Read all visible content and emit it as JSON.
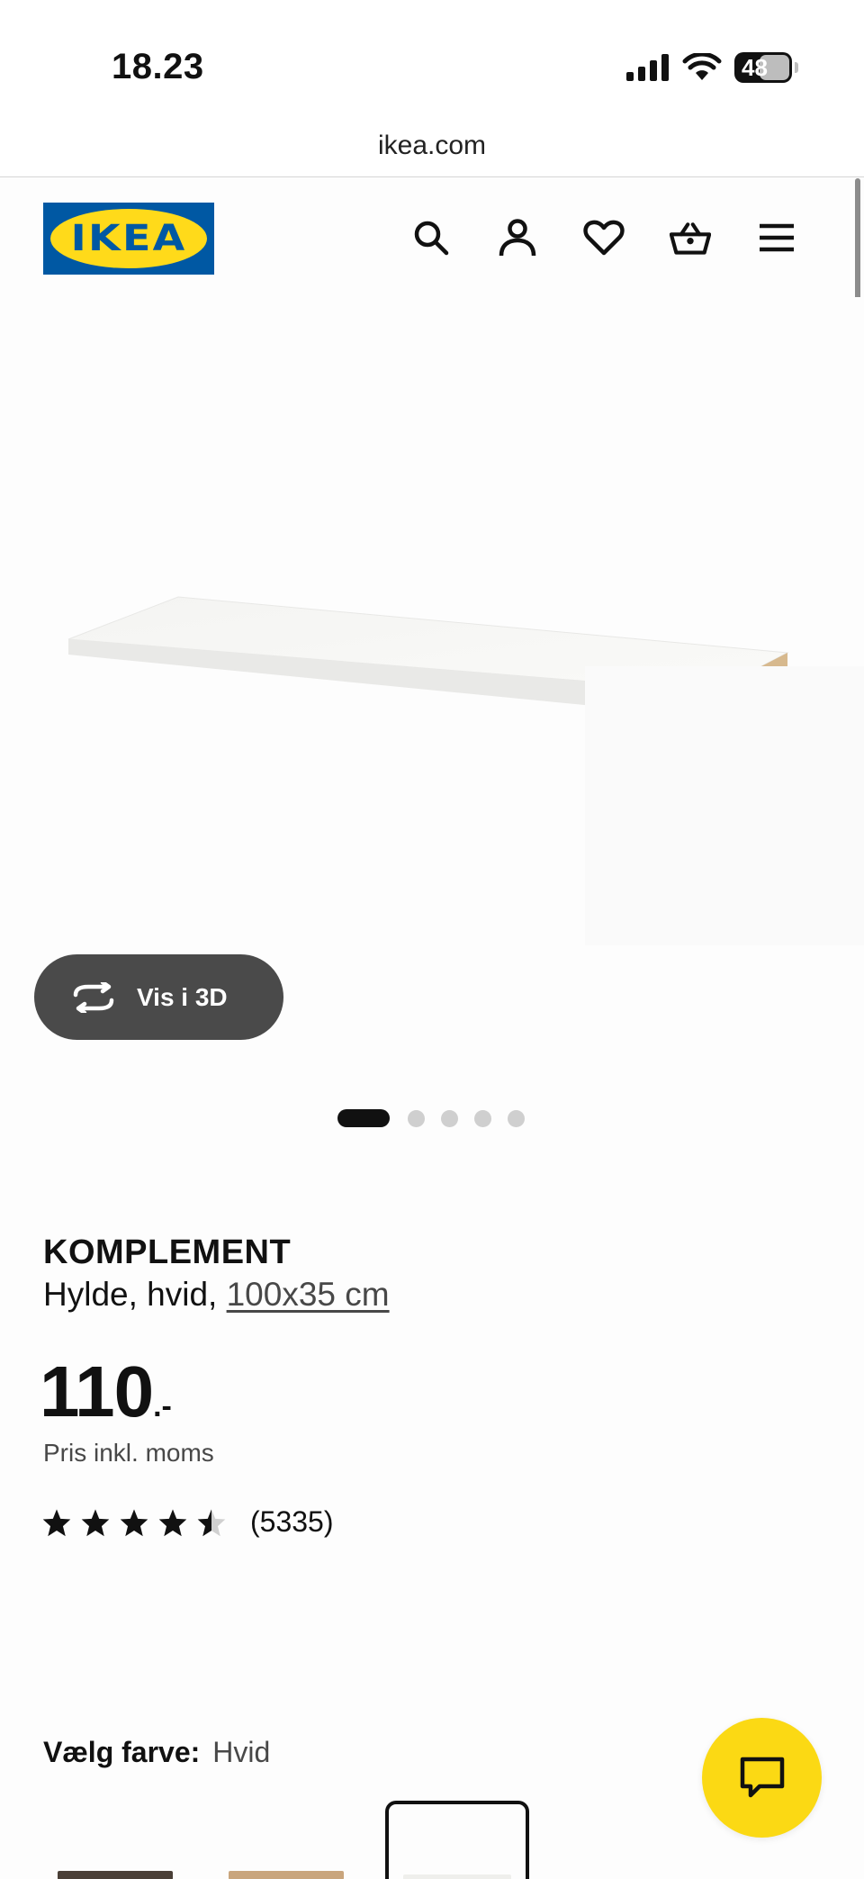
{
  "status_bar": {
    "time": "18.23",
    "battery_level": "48"
  },
  "browser": {
    "url": "ikea.com"
  },
  "header": {
    "logo_text": "IKEA",
    "icons": [
      "search-icon",
      "account-icon",
      "heart-icon",
      "basket-icon",
      "menu-icon"
    ]
  },
  "gallery": {
    "view_3d_label": "Vis i 3D",
    "image_count": 5,
    "active_index": 0
  },
  "product": {
    "name": "KOMPLEMENT",
    "description": "Hylde, hvid,",
    "size_link": "100x35 cm",
    "price_integer": "110",
    "price_suffix": ".-",
    "vat_note": "Pris inkl. moms",
    "rating_value": 4.5,
    "rating_max": 5,
    "review_count": "(5335)"
  },
  "color_selector": {
    "label": "Vælg farve:",
    "selected": "Hvid",
    "swatch_colors": [
      "#4a3f37",
      "#c9a57c",
      "#f4f4f2"
    ]
  },
  "colors": {
    "logo_blue": "#0058a3",
    "logo_yellow": "#ffda1a",
    "chat_yellow": "#fbd914",
    "button_dark": "#4a4a4a"
  }
}
